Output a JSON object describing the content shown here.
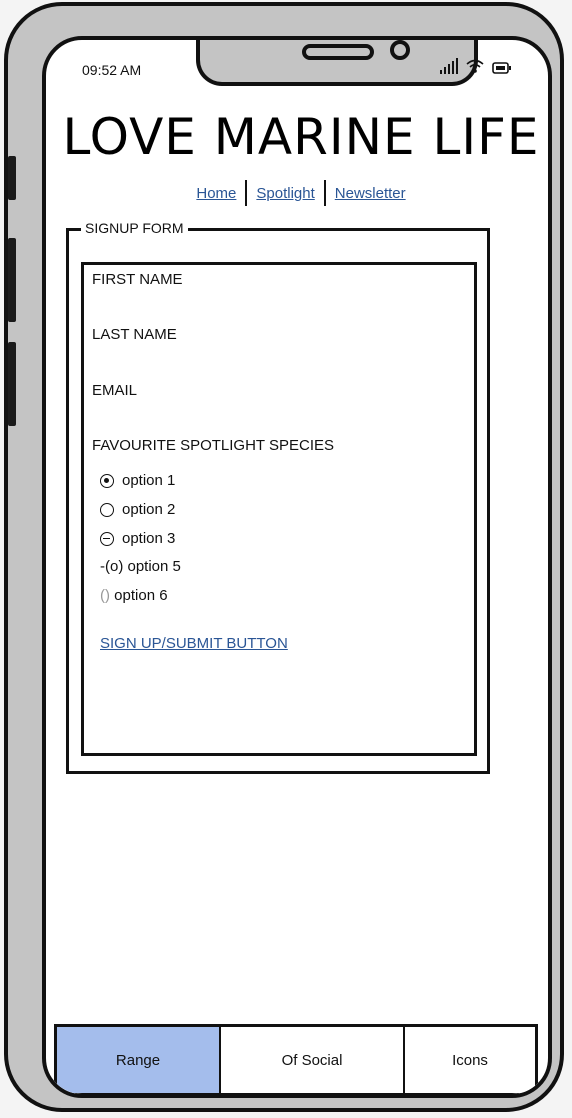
{
  "status_bar": {
    "time": "09:52 AM",
    "icons": [
      "signal-icon",
      "wifi-icon",
      "battery-icon"
    ]
  },
  "header": {
    "title": "LOVE MARINE LIFE"
  },
  "nav": {
    "items": [
      {
        "label": "Home"
      },
      {
        "label": "Spotlight"
      },
      {
        "label": "Newsletter"
      }
    ]
  },
  "form": {
    "legend": "SIGNUP FORM",
    "fields": {
      "first_name": "FIRST NAME",
      "last_name": "LAST NAME",
      "email": "EMAIL",
      "species": "FAVOURITE SPOTLIGHT SPECIES"
    },
    "options": [
      {
        "label": "option 1",
        "state": "selected"
      },
      {
        "label": "option 2",
        "state": "unselected"
      },
      {
        "label": "option 3",
        "state": "disabled"
      }
    ],
    "raw_options": [
      {
        "prefix": "-(o)",
        "label": " option 5"
      },
      {
        "prefix": "()",
        "label": " option 6"
      }
    ],
    "submit_label": "SIGN UP/SUBMIT BUTTON"
  },
  "tabbar": {
    "tabs": [
      {
        "label": "Range",
        "active": true
      },
      {
        "label": "Of Social",
        "active": false
      },
      {
        "label": "Icons",
        "active": false
      }
    ],
    "active_color": "#a4bdec"
  },
  "colors": {
    "link": "#2a5595",
    "phone_frame": "#c4c4c4"
  }
}
